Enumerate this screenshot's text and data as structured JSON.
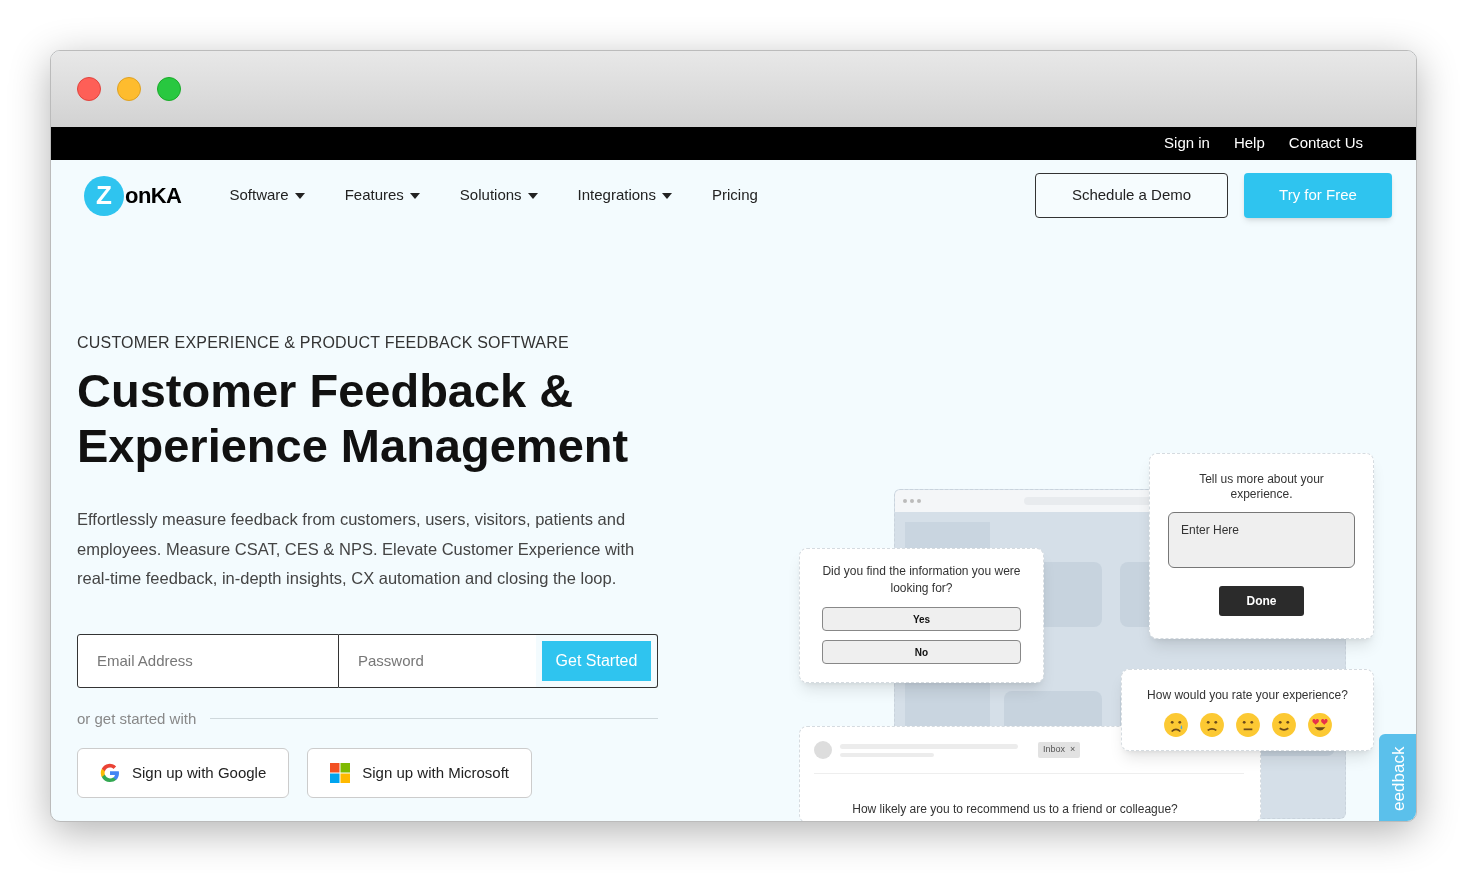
{
  "top_bar": {
    "links": [
      "Sign in",
      "Help",
      "Contact Us"
    ]
  },
  "logo": {
    "initial": "Z",
    "rest": "onKA"
  },
  "nav": {
    "items": [
      {
        "label": "Software",
        "dropdown": true
      },
      {
        "label": "Features",
        "dropdown": true
      },
      {
        "label": "Solutions",
        "dropdown": true
      },
      {
        "label": "Integrations",
        "dropdown": true
      },
      {
        "label": "Pricing",
        "dropdown": false
      }
    ],
    "demo_button": "Schedule a Demo",
    "trial_button": "Try for Free"
  },
  "hero": {
    "eyebrow": "CUSTOMER EXPERIENCE & PRODUCT FEEDBACK SOFTWARE",
    "title_lines": [
      "Customer Feedback &",
      "Experience Management"
    ],
    "description": "Effortlessly measure feedback from customers, users, visitors, patients and employees. Measure CSAT, CES & NPS. Elevate Customer Experience with real-time feedback, in-depth insights, CX automation and closing the loop.",
    "form": {
      "email_placeholder": "Email Address",
      "password_placeholder": "Password",
      "submit": "Get Started"
    },
    "divider_label": "or get started with",
    "social_buttons": [
      {
        "kind": "google",
        "label": "Sign up with Google"
      },
      {
        "kind": "microsoft",
        "label": "Sign up with Microsoft"
      }
    ]
  },
  "illustration": {
    "question_card": {
      "question": "Did you find the information you were looking for?",
      "options": [
        "Yes",
        "No"
      ]
    },
    "text_card": {
      "prompt": "Tell us more about your experience.",
      "placeholder": "Enter Here",
      "button": "Done"
    },
    "rating_card": {
      "question": "How would you rate your experience?"
    },
    "email_card": {
      "tag": "Inbox",
      "tag_close": "×",
      "question": "How likely are you to recommend us to a friend or colleague?"
    },
    "feedback_tab": "eedback"
  }
}
